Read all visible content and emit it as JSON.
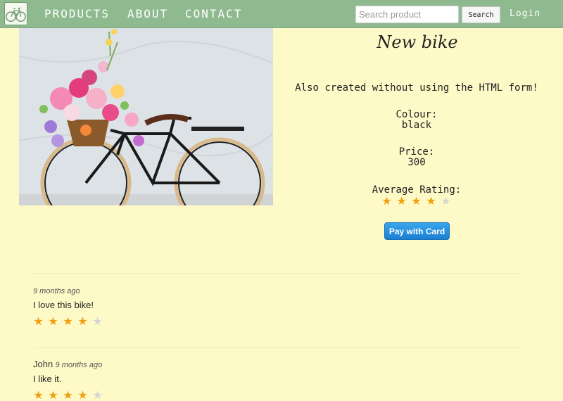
{
  "nav": {
    "links": [
      "PRODUCTS",
      "ABOUT",
      "CONTACT"
    ],
    "search_placeholder": "Search product",
    "search_label": "Search",
    "login_label": "Login"
  },
  "product": {
    "title": "New bike",
    "description": "Also created without using the HTML form!",
    "colour_label": "Colour:",
    "colour_value": "black",
    "price_label": "Price:",
    "price_value": "300",
    "rating_label": "Average Rating:",
    "rating": 4,
    "rating_max": 5,
    "pay_label": "Pay with Card"
  },
  "reviews": [
    {
      "author": "",
      "time": "9 months ago",
      "text": "I love this bike!",
      "rating": 4
    },
    {
      "author": "John",
      "time": "9 months ago",
      "text": "I like it.",
      "rating": 4
    }
  ],
  "colors": {
    "navbar": "#8fba8f",
    "background": "#fefac8",
    "star": "#f0a010",
    "pay_button": "#1a7fd0"
  },
  "icons": {
    "logo": "bicycle-logo-icon",
    "star": "star-icon"
  }
}
